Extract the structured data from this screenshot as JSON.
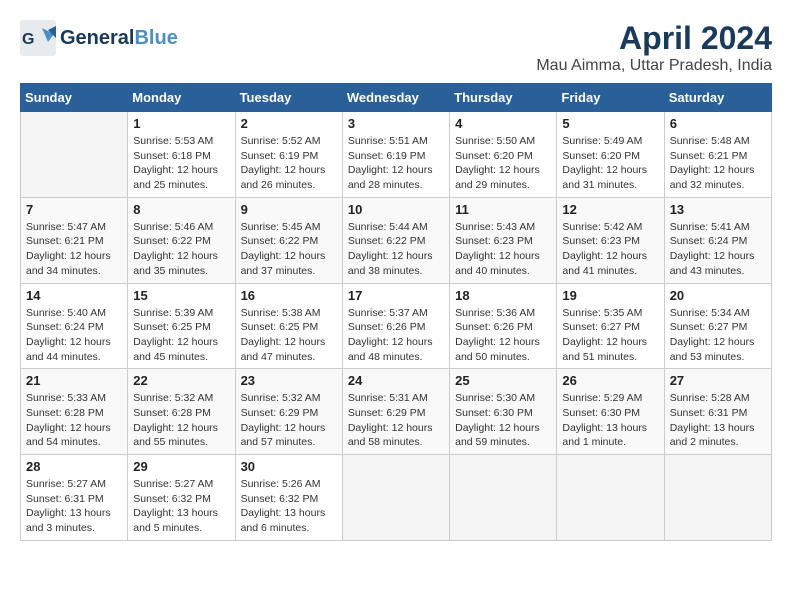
{
  "header": {
    "logo_line1": "General",
    "logo_line2": "Blue",
    "title": "April 2024",
    "subtitle": "Mau Aimma, Uttar Pradesh, India"
  },
  "weekdays": [
    "Sunday",
    "Monday",
    "Tuesday",
    "Wednesday",
    "Thursday",
    "Friday",
    "Saturday"
  ],
  "weeks": [
    [
      {
        "day": "",
        "empty": true
      },
      {
        "day": "1",
        "sunrise": "5:53 AM",
        "sunset": "6:18 PM",
        "daylight": "12 hours and 25 minutes."
      },
      {
        "day": "2",
        "sunrise": "5:52 AM",
        "sunset": "6:19 PM",
        "daylight": "12 hours and 26 minutes."
      },
      {
        "day": "3",
        "sunrise": "5:51 AM",
        "sunset": "6:19 PM",
        "daylight": "12 hours and 28 minutes."
      },
      {
        "day": "4",
        "sunrise": "5:50 AM",
        "sunset": "6:20 PM",
        "daylight": "12 hours and 29 minutes."
      },
      {
        "day": "5",
        "sunrise": "5:49 AM",
        "sunset": "6:20 PM",
        "daylight": "12 hours and 31 minutes."
      },
      {
        "day": "6",
        "sunrise": "5:48 AM",
        "sunset": "6:21 PM",
        "daylight": "12 hours and 32 minutes."
      }
    ],
    [
      {
        "day": "7",
        "sunrise": "5:47 AM",
        "sunset": "6:21 PM",
        "daylight": "12 hours and 34 minutes."
      },
      {
        "day": "8",
        "sunrise": "5:46 AM",
        "sunset": "6:22 PM",
        "daylight": "12 hours and 35 minutes."
      },
      {
        "day": "9",
        "sunrise": "5:45 AM",
        "sunset": "6:22 PM",
        "daylight": "12 hours and 37 minutes."
      },
      {
        "day": "10",
        "sunrise": "5:44 AM",
        "sunset": "6:22 PM",
        "daylight": "12 hours and 38 minutes."
      },
      {
        "day": "11",
        "sunrise": "5:43 AM",
        "sunset": "6:23 PM",
        "daylight": "12 hours and 40 minutes."
      },
      {
        "day": "12",
        "sunrise": "5:42 AM",
        "sunset": "6:23 PM",
        "daylight": "12 hours and 41 minutes."
      },
      {
        "day": "13",
        "sunrise": "5:41 AM",
        "sunset": "6:24 PM",
        "daylight": "12 hours and 43 minutes."
      }
    ],
    [
      {
        "day": "14",
        "sunrise": "5:40 AM",
        "sunset": "6:24 PM",
        "daylight": "12 hours and 44 minutes."
      },
      {
        "day": "15",
        "sunrise": "5:39 AM",
        "sunset": "6:25 PM",
        "daylight": "12 hours and 45 minutes."
      },
      {
        "day": "16",
        "sunrise": "5:38 AM",
        "sunset": "6:25 PM",
        "daylight": "12 hours and 47 minutes."
      },
      {
        "day": "17",
        "sunrise": "5:37 AM",
        "sunset": "6:26 PM",
        "daylight": "12 hours and 48 minutes."
      },
      {
        "day": "18",
        "sunrise": "5:36 AM",
        "sunset": "6:26 PM",
        "daylight": "12 hours and 50 minutes."
      },
      {
        "day": "19",
        "sunrise": "5:35 AM",
        "sunset": "6:27 PM",
        "daylight": "12 hours and 51 minutes."
      },
      {
        "day": "20",
        "sunrise": "5:34 AM",
        "sunset": "6:27 PM",
        "daylight": "12 hours and 53 minutes."
      }
    ],
    [
      {
        "day": "21",
        "sunrise": "5:33 AM",
        "sunset": "6:28 PM",
        "daylight": "12 hours and 54 minutes."
      },
      {
        "day": "22",
        "sunrise": "5:32 AM",
        "sunset": "6:28 PM",
        "daylight": "12 hours and 55 minutes."
      },
      {
        "day": "23",
        "sunrise": "5:32 AM",
        "sunset": "6:29 PM",
        "daylight": "12 hours and 57 minutes."
      },
      {
        "day": "24",
        "sunrise": "5:31 AM",
        "sunset": "6:29 PM",
        "daylight": "12 hours and 58 minutes."
      },
      {
        "day": "25",
        "sunrise": "5:30 AM",
        "sunset": "6:30 PM",
        "daylight": "12 hours and 59 minutes."
      },
      {
        "day": "26",
        "sunrise": "5:29 AM",
        "sunset": "6:30 PM",
        "daylight": "13 hours and 1 minute."
      },
      {
        "day": "27",
        "sunrise": "5:28 AM",
        "sunset": "6:31 PM",
        "daylight": "13 hours and 2 minutes."
      }
    ],
    [
      {
        "day": "28",
        "sunrise": "5:27 AM",
        "sunset": "6:31 PM",
        "daylight": "13 hours and 3 minutes."
      },
      {
        "day": "29",
        "sunrise": "5:27 AM",
        "sunset": "6:32 PM",
        "daylight": "13 hours and 5 minutes."
      },
      {
        "day": "30",
        "sunrise": "5:26 AM",
        "sunset": "6:32 PM",
        "daylight": "13 hours and 6 minutes."
      },
      {
        "day": "",
        "empty": true
      },
      {
        "day": "",
        "empty": true
      },
      {
        "day": "",
        "empty": true
      },
      {
        "day": "",
        "empty": true
      }
    ]
  ]
}
